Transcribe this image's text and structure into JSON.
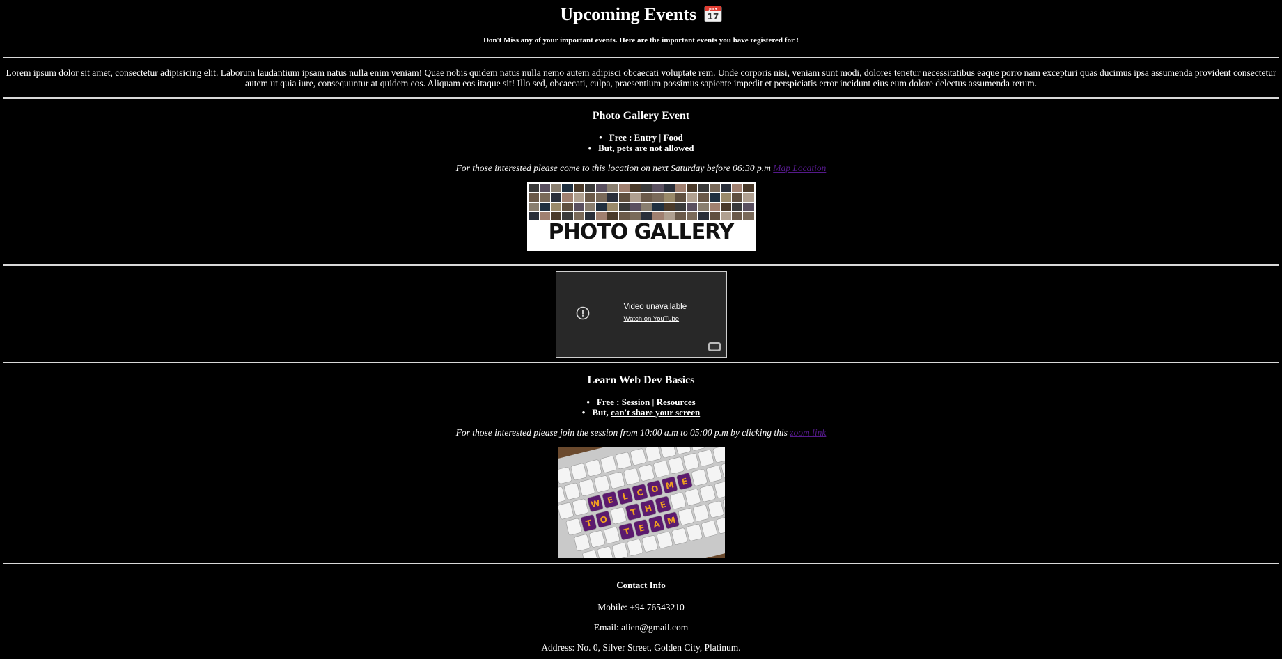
{
  "header": {
    "title": "Upcoming Events",
    "calendar_icon": "calendar-icon",
    "subtitle": "Don't Miss any of your important events. Here are the important events you have registered for !"
  },
  "intro": "Lorem ipsum dolor sit amet, consectetur adipisicing elit. Laborum laudantium ipsam natus nulla enim veniam! Quae nobis quidem natus nulla nemo autem adipisci obcaecati voluptate rem. Unde corporis nisi, veniam sunt modi, dolores tenetur necessitatibus eaque porro nam excepturi quas ducimus ipsa assumenda provident consectetur autem ut quia iure, consequuntur at quidem eos. Aliquam eos itaque sit! Illo sed, obcaecati, culpa, praesentium possimus sapiente impedit et perspiciatis error incidunt eius eum dolore delectus assumenda rerum.",
  "event1": {
    "title": "Photo Gallery Event",
    "bullet1": "Free : Entry | Food",
    "bullet2_prefix": "But,",
    "bullet2_link": "pets are not allowed",
    "note": "For those interested please come to this location on next Saturday before 06:30 p.m",
    "note_link": "Map Location",
    "image_text": "PHOTO GALLERY"
  },
  "video": {
    "title": "Video unavailable",
    "link": "Watch on YouTube"
  },
  "event2": {
    "title": "Learn Web Dev Basics",
    "bullet1": "Free : Session | Resources",
    "bullet2_prefix": "But,",
    "bullet2_link": "can't share your screen",
    "note": "For those interested please join the session from 10:00 a.m to 05:00 p.m by clicking this",
    "note_link": "zoom link",
    "image_text": "WELCOME TO THE TEAM"
  },
  "contact": {
    "heading": "Contact Info",
    "mobile": "Mobile: +94 76543210",
    "email": "Email: alien@gmail.com",
    "address": "Address: No. 0, Silver Street, Golden City, Platinum."
  },
  "colors": {
    "background": "#000000",
    "text": "#ffffff",
    "visited_link": "#551a8b",
    "video_bg": "#282828",
    "key_purple": "#5b1a6e",
    "key_letter": "#f0a020"
  }
}
